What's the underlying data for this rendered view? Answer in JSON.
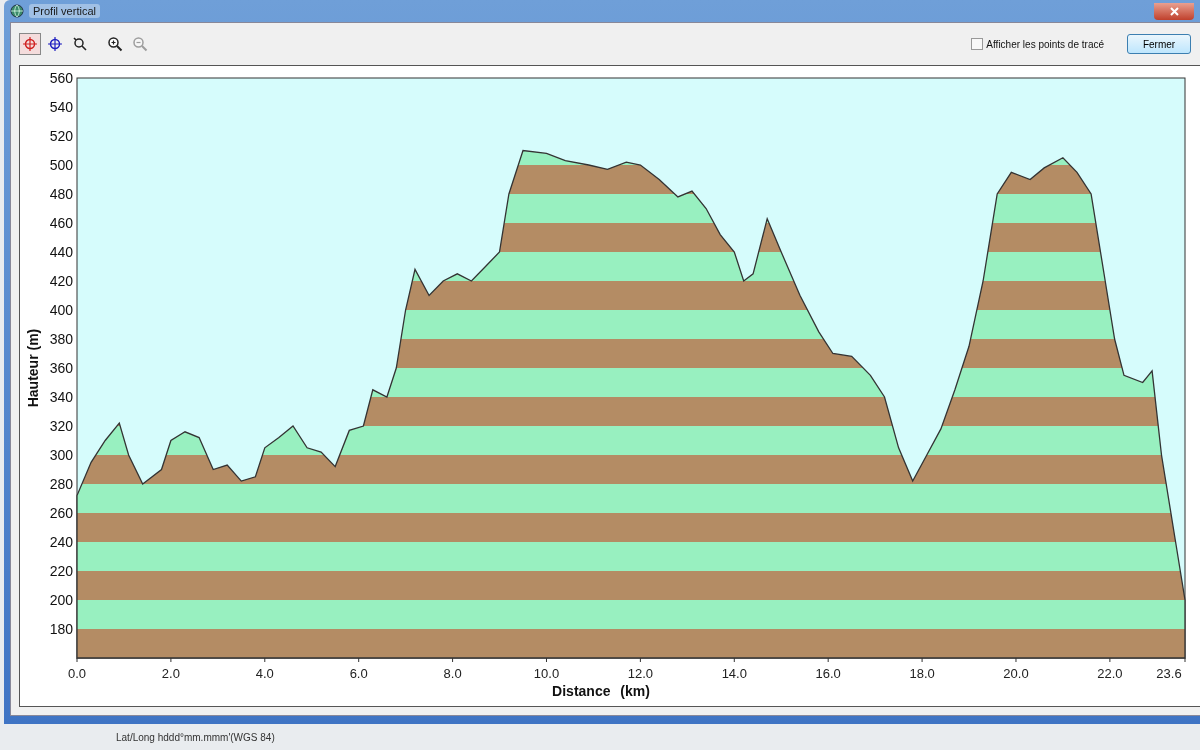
{
  "window": {
    "title": "Profil vertical"
  },
  "toolbar": {
    "tools": [
      {
        "kind": "select",
        "selected": true,
        "disabled": false
      },
      {
        "kind": "locate",
        "selected": false,
        "disabled": false
      },
      {
        "kind": "zoombox",
        "selected": false,
        "disabled": false
      },
      {
        "kind": "zoomin",
        "selected": false,
        "disabled": false
      },
      {
        "kind": "zoomout",
        "selected": false,
        "disabled": true
      }
    ],
    "checkbox": {
      "label": "Afficher les points de tracé",
      "checked": false
    },
    "close_button": "Fermer"
  },
  "chart": {
    "chart_data": {
      "type": "area",
      "xlabel": "Distance (km)",
      "ylabel": "Hauteur (m)",
      "x": [
        0,
        0.3,
        0.6,
        0.9,
        1.1,
        1.4,
        1.8,
        2.0,
        2.3,
        2.6,
        2.9,
        3.2,
        3.5,
        3.8,
        4.0,
        4.3,
        4.6,
        4.9,
        5.2,
        5.5,
        5.8,
        6.1,
        6.3,
        6.6,
        6.8,
        7.0,
        7.2,
        7.5,
        7.8,
        8.1,
        8.4,
        8.7,
        9.0,
        9.2,
        9.5,
        10.0,
        10.4,
        10.9,
        11.3,
        11.7,
        12.0,
        12.4,
        12.8,
        13.1,
        13.4,
        13.7,
        14.0,
        14.2,
        14.4,
        14.7,
        15.0,
        15.4,
        15.8,
        16.1,
        16.5,
        16.9,
        17.2,
        17.5,
        17.8,
        18.1,
        18.4,
        18.7,
        19.0,
        19.3,
        19.6,
        19.9,
        20.3,
        20.6,
        21.0,
        21.3,
        21.6,
        21.9,
        22.1,
        22.3,
        22.7,
        22.9,
        23.1,
        23.4,
        23.6
      ],
      "series": [
        {
          "values": [
            272,
            295,
            310,
            322,
            300,
            280,
            290,
            310,
            316,
            312,
            290,
            293,
            282,
            285,
            305,
            312,
            320,
            305,
            302,
            292,
            317,
            320,
            345,
            340,
            360,
            400,
            428,
            410,
            420,
            425,
            420,
            430,
            440,
            480,
            510,
            508,
            503,
            500,
            497,
            502,
            500,
            490,
            478,
            482,
            470,
            452,
            440,
            420,
            425,
            463,
            440,
            410,
            385,
            370,
            368,
            355,
            340,
            305,
            282,
            300,
            318,
            345,
            375,
            420,
            480,
            495,
            490,
            498,
            505,
            495,
            480,
            420,
            380,
            355,
            350,
            358,
            300,
            240,
            200
          ]
        }
      ],
      "xlim": [
        0,
        23.6
      ],
      "ylim": [
        160,
        560
      ],
      "xticks": [
        {
          "value": 0,
          "label": "0.0"
        },
        {
          "value": 2,
          "label": "2.0"
        },
        {
          "value": 4,
          "label": "4.0"
        },
        {
          "value": 6,
          "label": "6.0"
        },
        {
          "value": 8,
          "label": "8.0"
        },
        {
          "value": 10,
          "label": "10.0"
        },
        {
          "value": 12,
          "label": "12.0"
        },
        {
          "value": 14,
          "label": "14.0"
        },
        {
          "value": 16,
          "label": "16.0"
        },
        {
          "value": 18,
          "label": "18.0"
        },
        {
          "value": 20,
          "label": "20.0"
        },
        {
          "value": 22,
          "label": "22.0"
        },
        {
          "value": 23.6,
          "label": "23.6"
        }
      ],
      "yticks": [
        180,
        200,
        220,
        240,
        260,
        280,
        300,
        320,
        340,
        360,
        380,
        400,
        420,
        440,
        460,
        480,
        500,
        520,
        540,
        560
      ]
    }
  },
  "status_bar": {
    "text": "Lat/Long hddd°mm.mmm'(WGS 84)"
  }
}
